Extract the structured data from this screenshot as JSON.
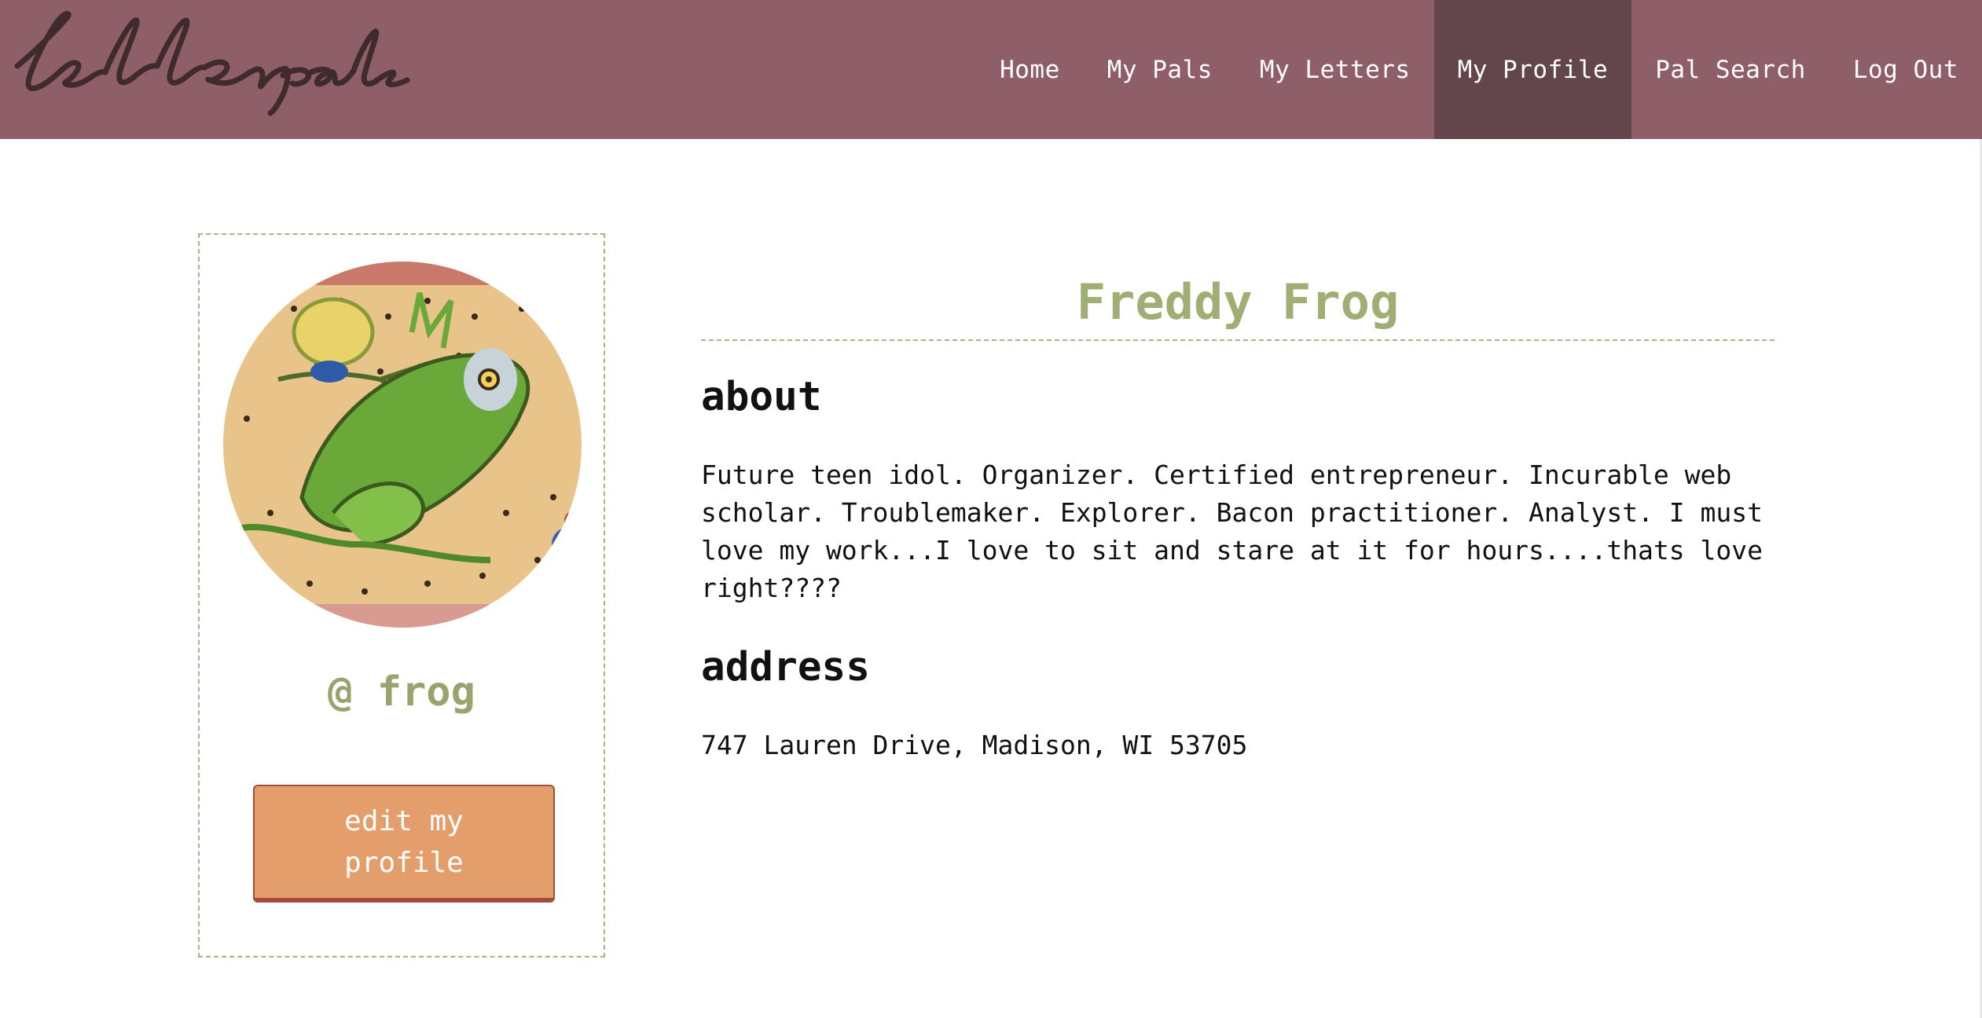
{
  "nav": {
    "logo_text": "letterpals",
    "items": [
      {
        "label": "Home"
      },
      {
        "label": "My Pals"
      },
      {
        "label": "My Letters"
      },
      {
        "label": "My Profile",
        "active": true
      },
      {
        "label": "Pal Search"
      },
      {
        "label": "Log Out"
      }
    ]
  },
  "profile": {
    "avatar_icon": "frog-illustration",
    "handle": "@ frog",
    "edit_button_label": "edit my profile"
  },
  "main": {
    "name": "Freddy Frog",
    "about_heading": "about",
    "about_text": "Future teen idol. Organizer. Certified entrepreneur. Incurable web scholar. Troublemaker. Explorer. Bacon practitioner. Analyst. I must love my work...I love to sit and stare at it for hours....thats love right????",
    "address_heading": "address",
    "address_text": "747 Lauren Drive, Madison, WI 53705"
  },
  "colors": {
    "nav_bg": "#8f5f69",
    "nav_active_bg": "#63464c",
    "accent_green": "#9fae72",
    "button_bg": "#e39e6c",
    "button_border": "#a44d3d"
  }
}
